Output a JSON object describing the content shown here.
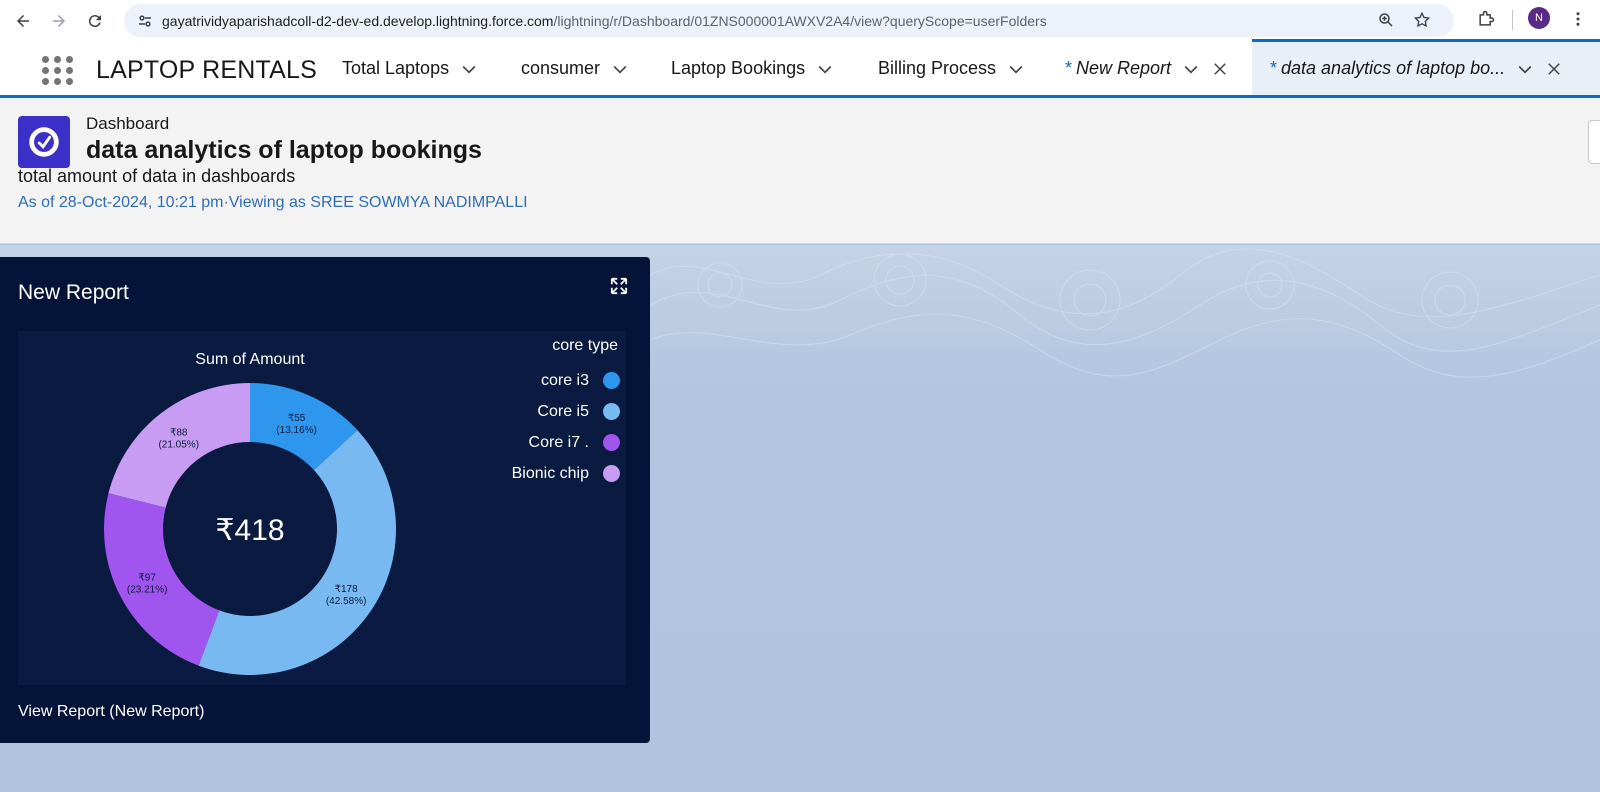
{
  "browser": {
    "url_host": "gayatrividyaparishadcoll-d2-dev-ed.develop.lightning.force.com",
    "url_path": "/lightning/r/Dashboard/01ZNS000001AWXV2A4/view?queryScope=userFolders",
    "avatar_letter": "N"
  },
  "app": {
    "name": "LAPTOP RENTALS",
    "tabs": [
      {
        "label": "Total Laptops"
      },
      {
        "label": "consumer"
      },
      {
        "label": "Laptop Bookings"
      },
      {
        "label": "Billing Process"
      },
      {
        "label": "New Report",
        "star": "*"
      },
      {
        "label": "data analytics of laptop bo...",
        "star": "*"
      }
    ]
  },
  "dashboard": {
    "type_label": "Dashboard",
    "title": "data analytics of laptop bookings",
    "description": "total amount of data in dashboards",
    "meta": "As of 28-Oct-2024, 10:21 pm·Viewing as SREE SOWMYA NADIMPALLI"
  },
  "widget": {
    "title": "New Report",
    "footer_link": "View Report (New Report)"
  },
  "chart_data": {
    "type": "pie",
    "title": "Sum of Amount",
    "center_total": "₹418",
    "legend_title": "core type",
    "legend_position": "top-right",
    "categories": [
      "core i3",
      "Core i5",
      "Core i7 .",
      "Bionic chip"
    ],
    "values": [
      55,
      178,
      97,
      88
    ],
    "value_labels": [
      "₹55",
      "₹178",
      "₹97",
      "₹88"
    ],
    "percent_labels": [
      "(13.16%)",
      "(42.58%)",
      "(23.21%)",
      "(21.05%)"
    ],
    "colors": [
      "#2f96ee",
      "#78b9f2",
      "#9f55ee",
      "#c79cf2"
    ]
  }
}
